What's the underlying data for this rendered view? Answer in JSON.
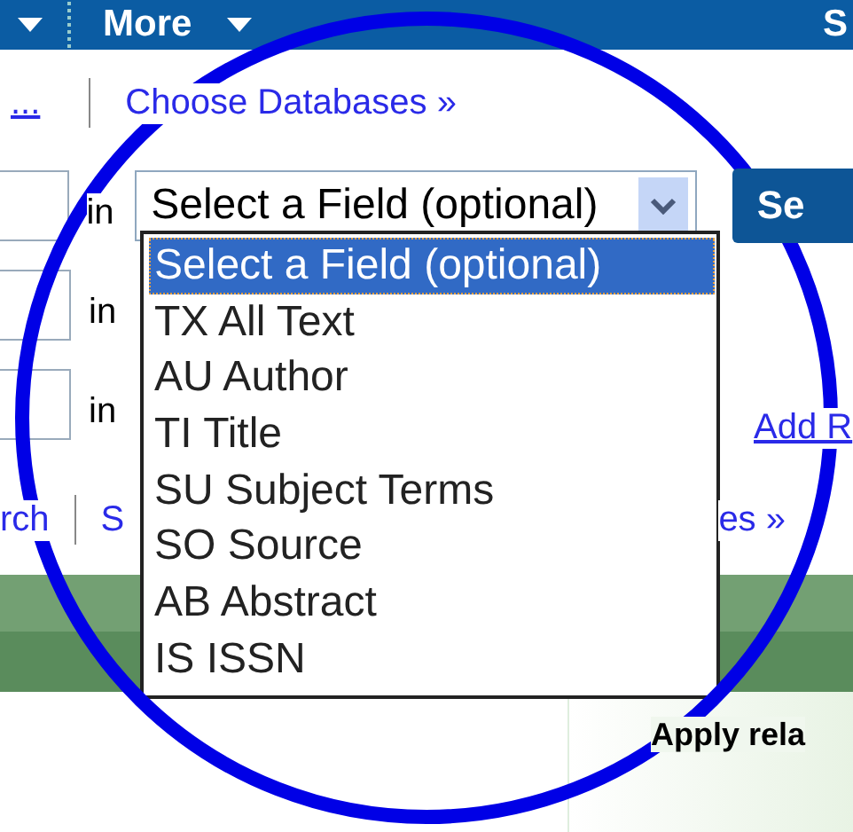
{
  "top_bar": {
    "menu_label": "More",
    "right_text": "S"
  },
  "links_row": {
    "left_link": "...",
    "choose_link": "Choose Databases »"
  },
  "search_rows": [
    {
      "in_label": "in",
      "field_select": "Select a Field (optional)",
      "button": "Se"
    },
    {
      "in_label": "in"
    },
    {
      "in_label": "in",
      "link": "Add R"
    }
  ],
  "bottom_links": [
    "rch",
    "S",
    "es »"
  ],
  "dropdown": {
    "options": [
      {
        "label": "Select a Field (optional)",
        "selected": true
      },
      {
        "label": "TX All Text",
        "selected": false
      },
      {
        "label": "AU Author",
        "selected": false
      },
      {
        "label": "TI Title",
        "selected": false
      },
      {
        "label": "SU Subject Terms",
        "selected": false
      },
      {
        "label": "SO Source",
        "selected": false
      },
      {
        "label": "AB Abstract",
        "selected": false
      },
      {
        "label": "IS ISSN",
        "selected": false
      }
    ]
  },
  "side_panel": {
    "heading": "Apply rela"
  }
}
